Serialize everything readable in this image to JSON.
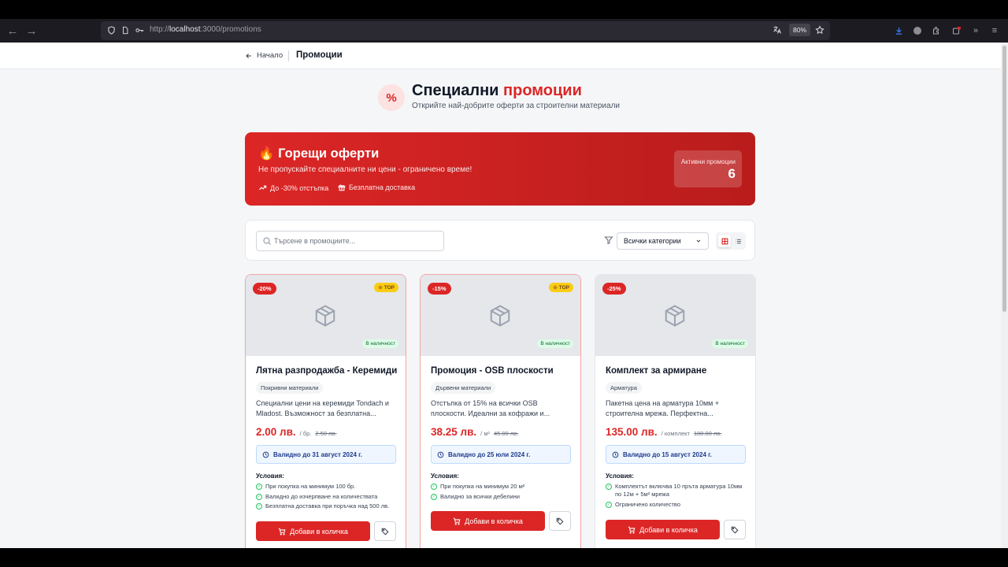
{
  "browser": {
    "url_prefix": "http://",
    "url_host": "localhost",
    "url_path": ":3000/promotions",
    "zoom": "80%"
  },
  "header": {
    "back_label": "Начало",
    "title": "Промоции"
  },
  "hero": {
    "icon": "%",
    "title_main": "Специални",
    "title_accent": "промоции",
    "subtitle": "Открийте най-добрите оферти за строителни материали"
  },
  "banner": {
    "title": "Горещи оферти",
    "subtitle": "Не пропускайте специалните ни цени - ограничено време!",
    "feature1": "До -30% отстъпка",
    "feature2": "Безплатна доставка",
    "active_label": "Активни промоции",
    "active_count": "6"
  },
  "filters": {
    "search_placeholder": "Търсене в промоциите...",
    "category": "Всички категории"
  },
  "cards": [
    {
      "discount": "-20%",
      "top": "☆ TOP",
      "stock": "В наличност",
      "title": "Лятна разпродажба - Керемиди",
      "category": "Покривни материали",
      "description": "Специални цени на керемиди Tondach и Mladost. Възможност за безплатна...",
      "price": "2.00 лв.",
      "unit": "/ бр.",
      "old_price": "2.50 лв.",
      "valid": "Валидно до 31 август 2024 г.",
      "conditions_title": "Условия:",
      "conditions": [
        "При покупка на минимум 100 бр.",
        "Валидно до изчерпване на количествата",
        "Безплатна доставка при поръчка над 500 лв."
      ],
      "add_label": "Добави в количка"
    },
    {
      "discount": "-15%",
      "top": "☆ TOP",
      "stock": "В наличност",
      "title": "Промоция - OSB плоскости",
      "category": "Дървени материали",
      "description": "Отстъпка от 15% на всички OSB плоскости. Идеални за кофражи и...",
      "price": "38.25 лв.",
      "unit": "/ м²",
      "old_price": "45.00 лв.",
      "valid": "Валидно до 25 юли 2024 г.",
      "conditions_title": "Условия:",
      "conditions": [
        "При покупка на минимум 20 м²",
        "Валидно за всички дебелини"
      ],
      "add_label": "Добави в количка"
    },
    {
      "discount": "-25%",
      "stock": "В наличност",
      "title": "Комплект за армиране",
      "category": "Арматура",
      "description": "Пакетна цена на арматура 10мм + строителна мрежа. Перфектна...",
      "price": "135.00 лв.",
      "unit": "/ комплект",
      "old_price": "180.00 лв.",
      "valid": "Валидно до 15 август 2024 г.",
      "conditions_title": "Условия:",
      "conditions": [
        "Комплектът включва 10 пръта арматура 10мм по 12м + 5м² мрежа",
        "Ограничено количество"
      ],
      "add_label": "Добави в количка"
    }
  ]
}
